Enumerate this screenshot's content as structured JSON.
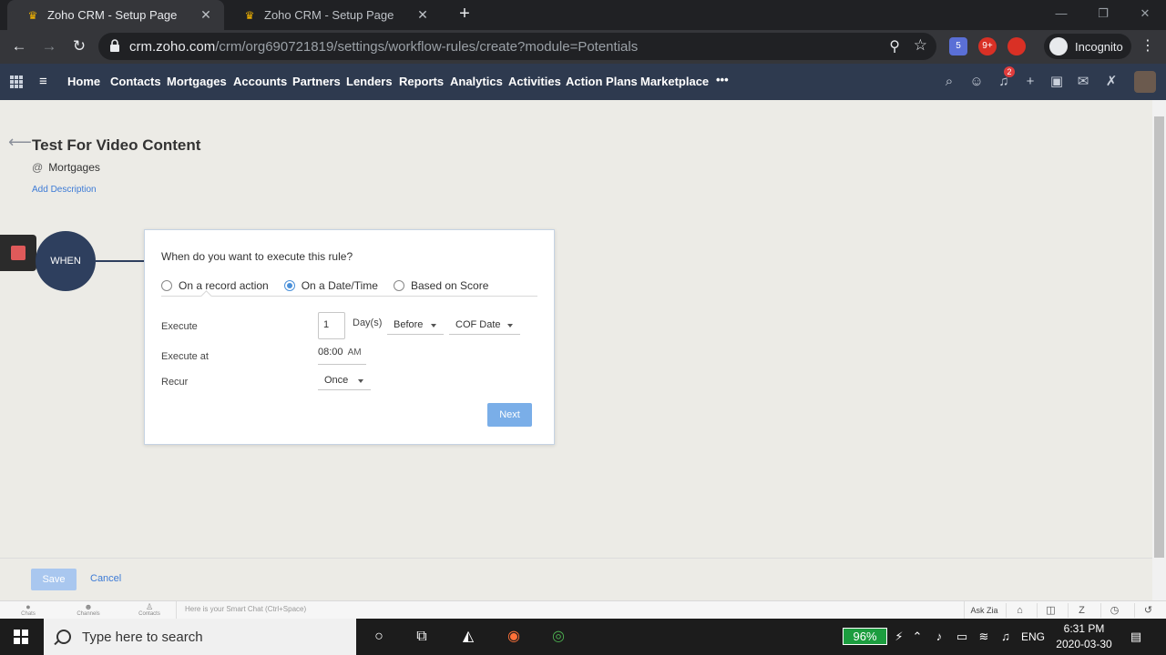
{
  "browser": {
    "tabs": [
      {
        "title": "Zoho CRM - Setup Page",
        "active": true
      },
      {
        "title": "Zoho CRM - Setup Page",
        "active": false
      }
    ],
    "url_host": "crm.zoho.com",
    "url_path": "/crm/org690721819/settings/workflow-rules/create?module=Potentials",
    "extensions": [
      {
        "icon": "calendar-extension-icon",
        "badge": "5",
        "color": "#5a6fd6"
      },
      {
        "icon": "notification-extension-icon",
        "badge": "9+",
        "color": "#d93025"
      },
      {
        "icon": "chat-extension-icon",
        "badge": "",
        "color": "#d93025"
      }
    ],
    "incognito_label": "Incognito"
  },
  "zoho_nav": {
    "items": [
      "Home",
      "Contacts",
      "Mortgages",
      "Accounts",
      "Partners",
      "Lenders",
      "Reports",
      "Analytics",
      "Activities",
      "Action Plans",
      "Marketplace"
    ],
    "more": "•••",
    "notification_count": "2"
  },
  "rule": {
    "title": "Test For Video Content",
    "at_symbol": "@",
    "module": "Mortgages",
    "add_description": "Add Description"
  },
  "flow": {
    "when_label": "WHEN"
  },
  "trigger_card": {
    "question": "When do you want to execute this rule?",
    "options": [
      {
        "label": "On a record action",
        "selected": false
      },
      {
        "label": "On a Date/Time",
        "selected": true
      },
      {
        "label": "Based on Score",
        "selected": false
      }
    ],
    "execute_label": "Execute",
    "execute_value": "1",
    "execute_unit": "Day(s)",
    "relation": "Before",
    "date_field": "COF Date",
    "execute_at_label": "Execute at",
    "execute_at_time": "08:00",
    "execute_at_ampm": "AM",
    "recur_label": "Recur",
    "recur_value": "Once",
    "next_label": "Next"
  },
  "footer": {
    "save_label": "Save",
    "cancel_label": "Cancel"
  },
  "chatbar": {
    "items": [
      "Chats",
      "Channels",
      "Contacts"
    ],
    "smart_chat_placeholder": "Here is your Smart Chat (Ctrl+Space)",
    "ask_zia": "Ask Zia"
  },
  "taskbar": {
    "search_placeholder": "Type here to search",
    "battery": "96%",
    "language": "ENG",
    "time": "6:31 PM",
    "date": "2020-03-30"
  }
}
